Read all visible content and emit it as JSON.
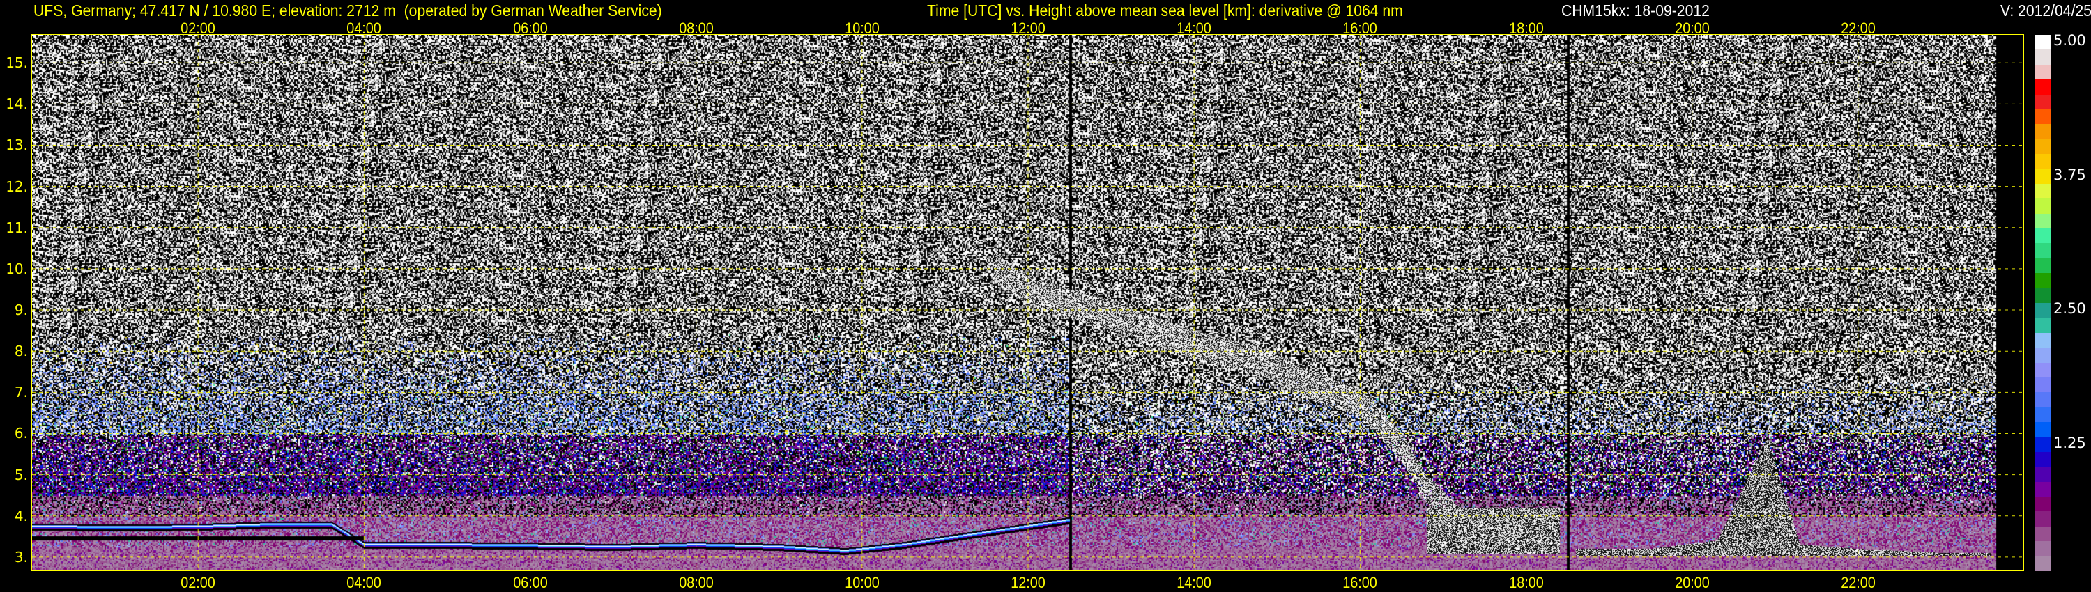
{
  "header": {
    "station": "UFS, Germany; 47.417 N / 10.980 E; elevation: 2712 m  (operated by German Weather Service)",
    "axes_title": "Time [UTC] vs. Height above mean sea level [km]: derivative @ 1064 nm",
    "instrument_date": "CHM15kx: 18-09-2012",
    "version": "V: 2012/04/25"
  },
  "chart_data": {
    "type": "heatmap",
    "title": "Time [UTC] vs. Height above mean sea level [km]: derivative @ 1064 nm",
    "xlabel": "Time [UTC]",
    "ylabel": "Height above mean sea level [km]",
    "xlim_hours": [
      0,
      24
    ],
    "ylim_km": [
      2.66,
      15.68
    ],
    "grid": true,
    "x_ticks": [
      {
        "hour": 2,
        "label": "02:00"
      },
      {
        "hour": 4,
        "label": "04:00"
      },
      {
        "hour": 6,
        "label": "06:00"
      },
      {
        "hour": 8,
        "label": "08:00"
      },
      {
        "hour": 10,
        "label": "10:00"
      },
      {
        "hour": 12,
        "label": "12:00"
      },
      {
        "hour": 14,
        "label": "14:00"
      },
      {
        "hour": 16,
        "label": "16:00"
      },
      {
        "hour": 18,
        "label": "18:00"
      },
      {
        "hour": 20,
        "label": "20:00"
      },
      {
        "hour": 22,
        "label": "22:00"
      }
    ],
    "y_ticks": [
      {
        "km": 3,
        "label": "3."
      },
      {
        "km": 4,
        "label": "4."
      },
      {
        "km": 5,
        "label": "5."
      },
      {
        "km": 6,
        "label": "6."
      },
      {
        "km": 7,
        "label": "7."
      },
      {
        "km": 8,
        "label": "8."
      },
      {
        "km": 9,
        "label": "9."
      },
      {
        "km": 10,
        "label": "10."
      },
      {
        "km": 11,
        "label": "11."
      },
      {
        "km": 12,
        "label": "12."
      },
      {
        "km": 13,
        "label": "13."
      },
      {
        "km": 14,
        "label": "14."
      },
      {
        "km": 15,
        "label": "15."
      }
    ],
    "data_end_hour": 23.65,
    "data_gaps_hours": [
      12.5,
      18.5
    ],
    "aerosol_layer_top_km": {
      "hours": [
        0,
        1,
        2,
        3,
        3.6,
        4,
        5,
        6,
        7,
        8,
        9,
        9.8,
        10.5,
        11,
        12,
        12.5
      ],
      "km": [
        3.75,
        3.72,
        3.74,
        3.8,
        3.8,
        3.3,
        3.3,
        3.28,
        3.25,
        3.3,
        3.25,
        3.15,
        3.3,
        3.45,
        3.75,
        3.9
      ]
    },
    "cloud_layer_km": {
      "hours": [
        11.6,
        12.0,
        12.5,
        13.0,
        14.0,
        14.8,
        15.4,
        16.0,
        16.5,
        16.8,
        17.2,
        18.0,
        18.4
      ],
      "km": [
        10.2,
        9.6,
        9.3,
        9.0,
        8.3,
        7.9,
        7.3,
        6.9,
        5.8,
        4.8,
        4.0,
        3.7,
        3.65
      ]
    },
    "low_cloud_km": {
      "hours": [
        18.6,
        19.5,
        20.3,
        20.6,
        20.9,
        21.3,
        22.0,
        23.0,
        23.6
      ],
      "km": [
        3.2,
        3.2,
        3.4,
        4.6,
        5.9,
        3.3,
        3.2,
        3.1,
        3.1
      ]
    },
    "colorbar": {
      "min": 0,
      "max": 5,
      "labels": [
        "5.00",
        "3.75",
        "2.50",
        "1.25"
      ],
      "label_values": [
        5.0,
        3.75,
        2.5,
        1.25
      ],
      "colors_top_to_bottom": [
        "#ffffff",
        "#e8e0e0",
        "#f0c0c0",
        "#ff0000",
        "#f02020",
        "#ff5a00",
        "#f89800",
        "#f8b000",
        "#fcc800",
        "#f8e000",
        "#e0f840",
        "#c0f840",
        "#90f880",
        "#40f0a0",
        "#30d880",
        "#20c050",
        "#20a000",
        "#109030",
        "#20a090",
        "#30c0a0",
        "#90c0f8",
        "#90a8f8",
        "#9090f8",
        "#7880f8",
        "#5878f8",
        "#3070f8",
        "#0060f8",
        "#0020e0",
        "#2000c8",
        "#5000b0",
        "#7800a0",
        "#800070",
        "#882080",
        "#985090",
        "#a070a0",
        "#a888a8"
      ]
    }
  }
}
